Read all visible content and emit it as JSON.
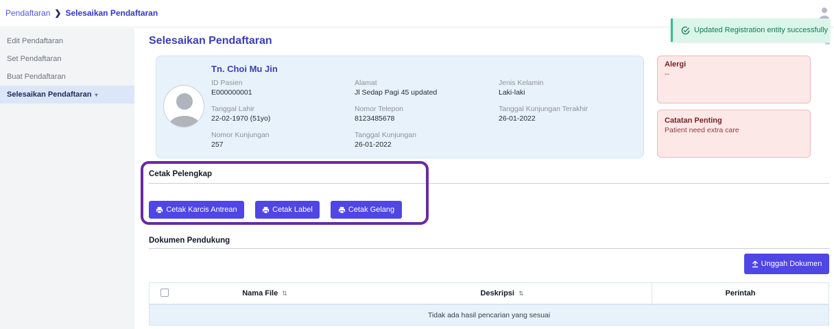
{
  "breadcrumb": {
    "parent": "Pendaftaran",
    "separator": "❯",
    "current": "Selesaikan Pendaftaran"
  },
  "sidebar": {
    "items": [
      {
        "label": "Edit Pendaftaran"
      },
      {
        "label": "Set Pendaftaran"
      },
      {
        "label": "Buat Pendaftaran"
      },
      {
        "label": "Selesaikan Pendaftaran",
        "caret": "▾",
        "active": true
      }
    ]
  },
  "main": {
    "title": "Selesaikan Pendaftaran"
  },
  "patient": {
    "name": "Tn. Choi Mu Jin",
    "fields": {
      "id": {
        "label": "ID Pasien",
        "value": "E000000001"
      },
      "dob": {
        "label": "Tanggal Lahir",
        "value": "22-02-1970 (51yo)"
      },
      "visit_no": {
        "label": "Nomor Kunjungan",
        "value": "257"
      },
      "address": {
        "label": "Alamat",
        "value": "Jl Sedap Pagi 45 updated"
      },
      "phone": {
        "label": "Nomor Telepon",
        "value": "8123485678"
      },
      "visit_date": {
        "label": "Tanggal Kunjungan",
        "value": "26-01-2022"
      },
      "gender": {
        "label": "Jenis Kelamin",
        "value": "Laki-laki"
      },
      "last_visit": {
        "label": "Tanggal Kunjungan Terakhir",
        "value": "26-01-2022"
      }
    }
  },
  "allergy": {
    "title": "Alergi",
    "text": "--"
  },
  "notes": {
    "title": "Catatan Penting",
    "text": "Patient need extra care"
  },
  "print_section": {
    "title": "Cetak Pelengkap",
    "buttons": {
      "queue_ticket": "Cetak Karcis Antrean",
      "label": "Cetak Label",
      "bracelet": "Cetak Gelang"
    }
  },
  "documents": {
    "title": "Dokumen Pendukung",
    "upload_label": "Unggah Dokumen",
    "columns": {
      "file_name": "Nama File",
      "description": "Deskripsi",
      "actions": "Perintah"
    },
    "sort_glyph": "⇅",
    "empty_text": "Tidak ada hasil pencarian yang sesuai"
  },
  "toast": {
    "message": "Updated Registration entity successfully"
  },
  "colors": {
    "primary": "#4f46e5",
    "title": "#3a3fb5",
    "highlight": "#6b2aa0",
    "toast_bg": "#daf6ea",
    "alert_bg": "#fde8e8"
  }
}
